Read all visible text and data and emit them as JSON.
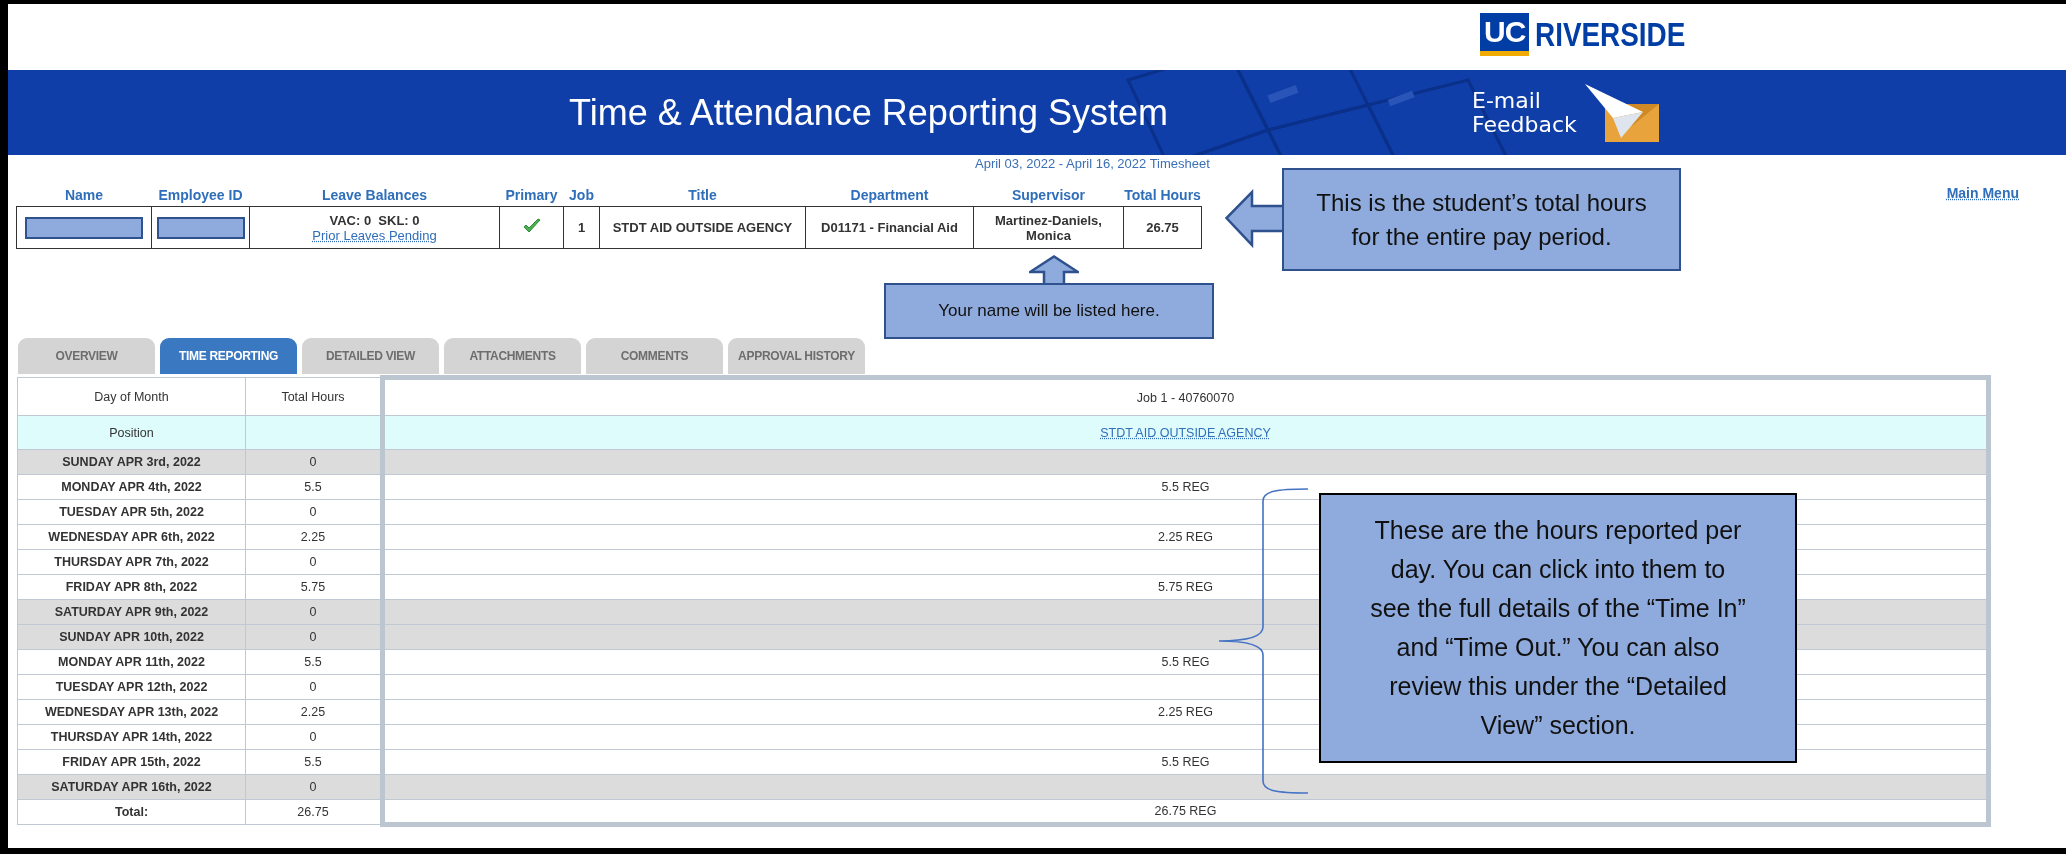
{
  "logo": {
    "mark": "UC",
    "name": "RIVERSIDE"
  },
  "banner": {
    "title": "Time & Attendance Reporting System",
    "feedback": [
      "E-mail",
      "Feedback"
    ]
  },
  "period": "April 03, 2022 - April 16, 2022 Timesheet",
  "main_menu": "Main Menu",
  "employee": {
    "columns": [
      "Name",
      "Employee ID",
      "Leave Balances",
      "Primary",
      "Job",
      "Title",
      "Department",
      "Supervisor",
      "Total Hours"
    ],
    "row": {
      "name_redacted": true,
      "id_redacted": true,
      "leave": "VAC: 0  SKL: 0",
      "leave_link": "Prior Leaves Pending",
      "primary": true,
      "job": "1",
      "title": "STDT AID OUTSIDE AGENCY",
      "department": "D01171 - Financial Aid",
      "supervisor": "Martinez-Daniels, Monica",
      "total_hours": "26.75"
    }
  },
  "tabs": [
    {
      "label": "OVERVIEW",
      "selected": false
    },
    {
      "label": "TIME REPORTING",
      "selected": true
    },
    {
      "label": "DETAILED VIEW",
      "selected": false
    },
    {
      "label": "ATTACHMENTS",
      "selected": false
    },
    {
      "label": "COMMENTS",
      "selected": false
    },
    {
      "label": "APPROVAL HISTORY",
      "selected": false
    }
  ],
  "timesheet": {
    "columns": [
      "Day of Month",
      "Total Hours",
      "Job 1 - 40760070"
    ],
    "position": {
      "label": "Position",
      "job": "STDT AID OUTSIDE AGENCY"
    },
    "days": [
      {
        "day": "SUNDAY APR 3rd, 2022",
        "hours": "0",
        "shaded": true
      },
      {
        "day": "MONDAY APR 4th, 2022",
        "hours": "5.5",
        "job": "5.5 REG",
        "shaded": false
      },
      {
        "day": "TUESDAY APR 5th, 2022",
        "hours": "0",
        "shaded": false
      },
      {
        "day": "WEDNESDAY APR 6th, 2022",
        "hours": "2.25",
        "job": "2.25 REG",
        "shaded": false
      },
      {
        "day": "THURSDAY APR 7th, 2022",
        "hours": "0",
        "shaded": false
      },
      {
        "day": "FRIDAY APR 8th, 2022",
        "hours": "5.75",
        "job": "5.75 REG",
        "shaded": false
      },
      {
        "day": "SATURDAY APR 9th, 2022",
        "hours": "0",
        "shaded": true
      },
      {
        "day": "SUNDAY APR 10th, 2022",
        "hours": "0",
        "shaded": true
      },
      {
        "day": "MONDAY APR 11th, 2022",
        "hours": "5.5",
        "job": "5.5 REG",
        "shaded": false
      },
      {
        "day": "TUESDAY APR 12th, 2022",
        "hours": "0",
        "shaded": false
      },
      {
        "day": "WEDNESDAY APR 13th, 2022",
        "hours": "2.25",
        "job": "2.25 REG",
        "shaded": false
      },
      {
        "day": "THURSDAY APR 14th, 2022",
        "hours": "0",
        "shaded": false
      },
      {
        "day": "FRIDAY APR 15th, 2022",
        "hours": "5.5",
        "job": "5.5 REG",
        "shaded": false
      },
      {
        "day": "SATURDAY APR 16th, 2022",
        "hours": "0",
        "shaded": true
      }
    ],
    "total": {
      "label": "Total:",
      "hours": "26.75",
      "job": "26.75 REG"
    }
  },
  "callouts": [
    {
      "kind": "arrow-left",
      "text": "This is the student’s total hours for the entire pay period."
    },
    {
      "kind": "arrow-up",
      "text": "Your name will be listed here."
    },
    {
      "kind": "brace",
      "text": "These are the hours reported per day. You can click into them to see the full details of the “Time In” and “Time Out.” You can also review this under the “Detailed View” section."
    }
  ]
}
